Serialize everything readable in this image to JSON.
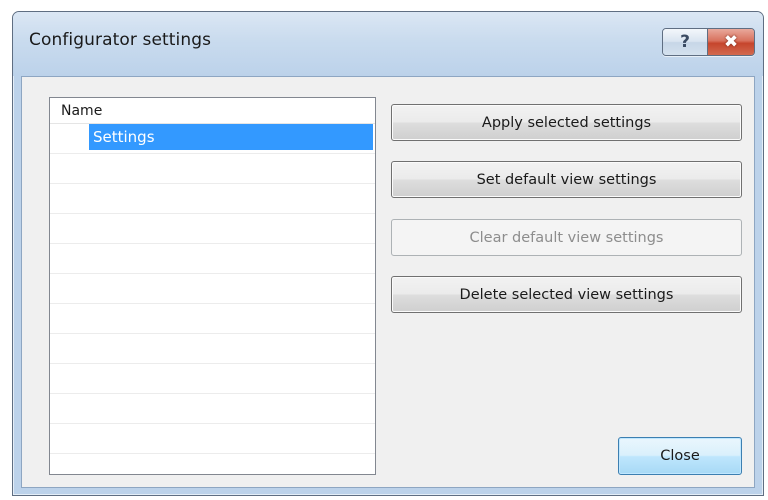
{
  "window": {
    "title": "Configurator settings",
    "help_label": "?",
    "close_label": "✖"
  },
  "list": {
    "column_header": "Name",
    "items": [
      {
        "label": "Settings",
        "selected": true
      }
    ]
  },
  "buttons": {
    "apply": "Apply selected settings",
    "set_default": "Set default view settings",
    "clear_default": "Clear default view settings",
    "delete": "Delete selected view settings",
    "close": "Close"
  },
  "colors": {
    "selection": "#3399ff",
    "window_frame": "#bcd2ea",
    "close_caption": "#c6452d"
  }
}
